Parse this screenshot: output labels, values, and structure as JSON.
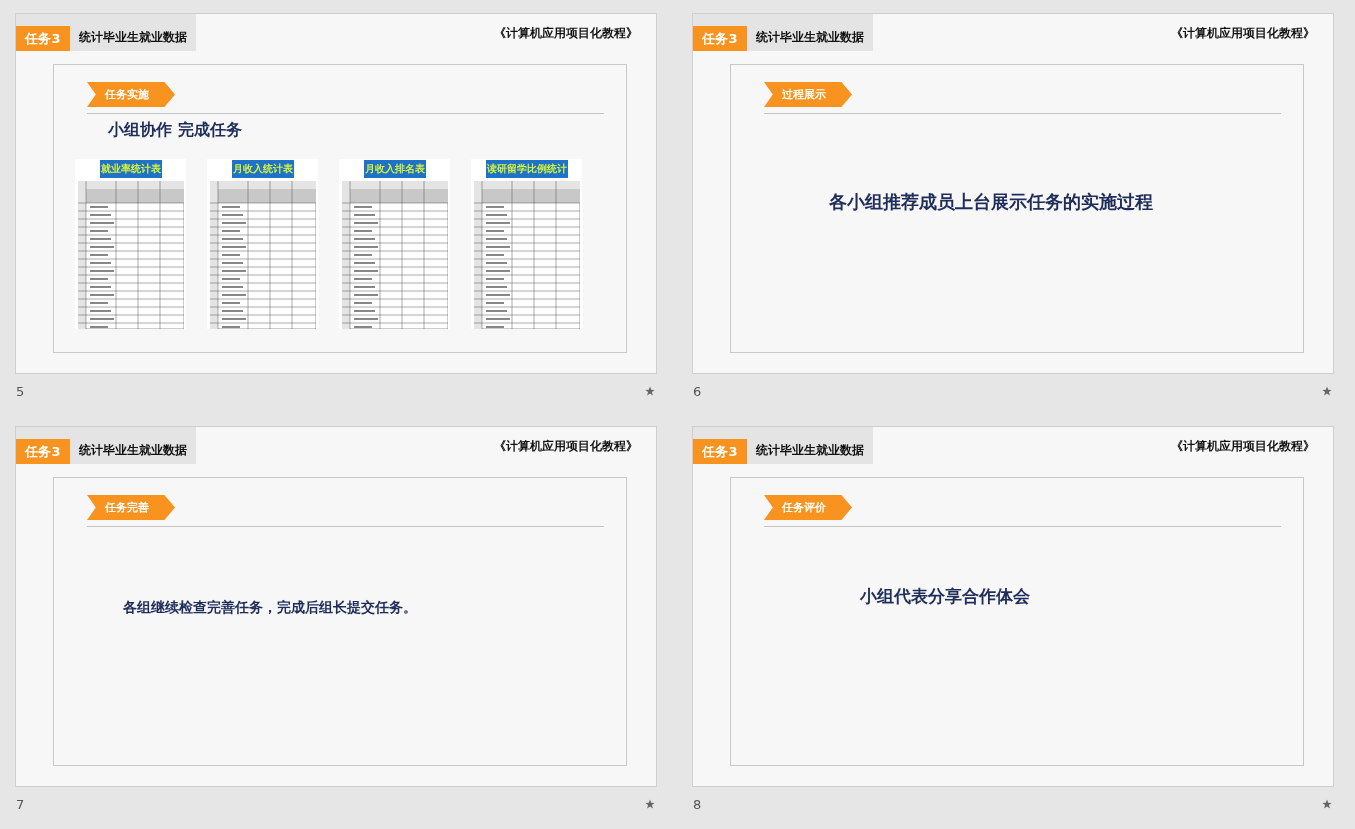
{
  "slides": [
    {
      "number": "5",
      "task_tag": "任务3",
      "task_title": "统计毕业生就业数据",
      "book_title": "《计算机应用项目化教程》",
      "section_tag": "任务实施",
      "kind": "tables",
      "heading": "小组协作  完成任务",
      "tables": [
        {
          "title": "就业率统计表"
        },
        {
          "title": "月收入统计表"
        },
        {
          "title": "月收入排名表"
        },
        {
          "title": "读研留学比例统计"
        }
      ]
    },
    {
      "number": "6",
      "task_tag": "任务3",
      "task_title": "统计毕业生就业数据",
      "book_title": "《计算机应用项目化教程》",
      "section_tag": "过程展示",
      "kind": "headline",
      "text": "各小组推荐成员上台展示任务的实施过程"
    },
    {
      "number": "7",
      "task_tag": "任务3",
      "task_title": "统计毕业生就业数据",
      "book_title": "《计算机应用项目化教程》",
      "section_tag": "任务完善",
      "kind": "note",
      "text": "各组继续检查完善任务，完成后组长提交任务。"
    },
    {
      "number": "8",
      "task_tag": "任务3",
      "task_title": "统计毕业生就业数据",
      "book_title": "《计算机应用项目化教程》",
      "section_tag": "任务评价",
      "kind": "callout",
      "text": "小组代表分享合作体会"
    }
  ]
}
